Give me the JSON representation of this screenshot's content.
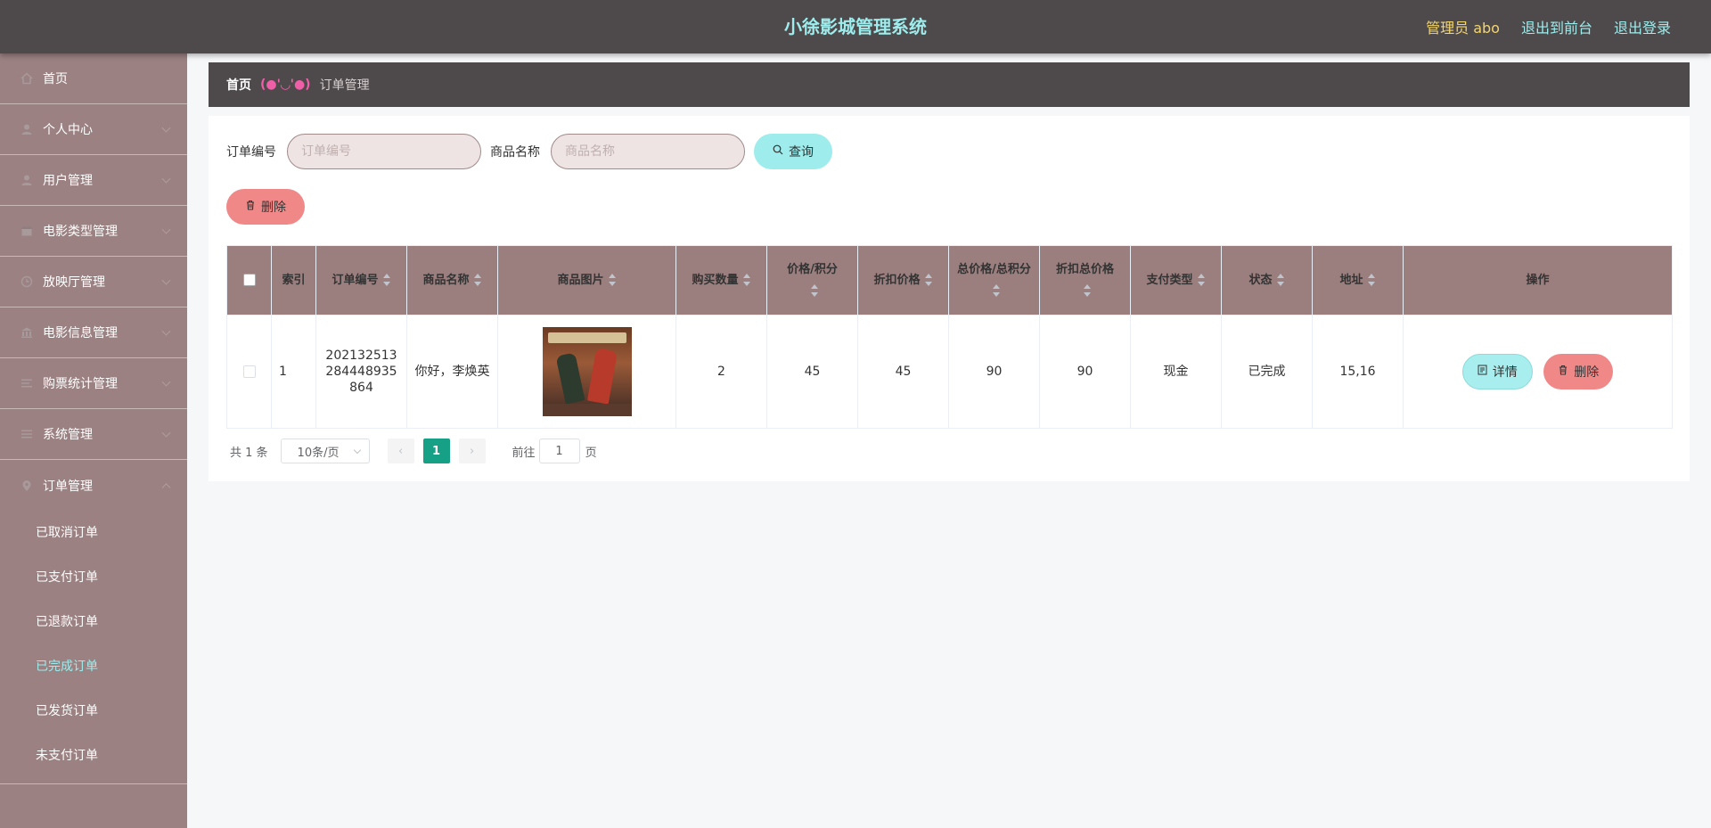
{
  "header": {
    "title": "小徐影城管理系统",
    "admin_label": "管理员 abo",
    "front_link": "退出到前台",
    "logout_link": "退出登录"
  },
  "sidebar": {
    "items": [
      {
        "label": "首页",
        "icon": "home-icon"
      },
      {
        "label": "个人中心",
        "icon": "user-icon"
      },
      {
        "label": "用户管理",
        "icon": "user-icon"
      },
      {
        "label": "电影类型管理",
        "icon": "calendar-icon"
      },
      {
        "label": "放映厅管理",
        "icon": "clock-icon"
      },
      {
        "label": "电影信息管理",
        "icon": "bank-icon"
      },
      {
        "label": "购票统计管理",
        "icon": "list-icon"
      },
      {
        "label": "系统管理",
        "icon": "menu-icon"
      },
      {
        "label": "订单管理",
        "icon": "location-icon"
      }
    ],
    "order_sub": [
      "已取消订单",
      "已支付订单",
      "已退款订单",
      "已完成订单",
      "已发货订单",
      "未支付订单"
    ],
    "active_sub": "已完成订单"
  },
  "breadcrumb": {
    "home": "首页",
    "separator": "(●'◡'●)",
    "current": "订单管理"
  },
  "search": {
    "order_no_label": "订单编号",
    "order_no_placeholder": "订单编号",
    "goods_name_label": "商品名称",
    "goods_name_placeholder": "商品名称",
    "query_button": "查询"
  },
  "toolbar": {
    "delete_button": "删除"
  },
  "table": {
    "columns": [
      "索引",
      "订单编号",
      "商品名称",
      "商品图片",
      "购买数量",
      "价格/积分",
      "折扣价格",
      "总价格/总积分",
      "折扣总价格",
      "支付类型",
      "状态",
      "地址",
      "操作"
    ],
    "rows": [
      {
        "index": "1",
        "order_no": "202132513284448935864",
        "goods_name": "你好，李焕英",
        "quantity": "2",
        "price": "45",
        "discount_price": "45",
        "total_price": "90",
        "discount_total": "90",
        "pay_type": "现金",
        "status": "已完成",
        "address": "15,16",
        "detail_button": "详情",
        "delete_button": "删除"
      }
    ]
  },
  "pagination": {
    "total": "共 1 条",
    "page_size": "10条/页",
    "current_page": "1",
    "goto_label": "前往",
    "goto_value": "1",
    "page_suffix": "页"
  },
  "colors": {
    "header_bg": "#4e4a4c",
    "sidebar_bg": "#9b8182",
    "accent_cyan": "#9eecec",
    "delete_red": "#f08888",
    "table_header_bg": "#9b7e7e",
    "pager_active": "#16a085"
  }
}
